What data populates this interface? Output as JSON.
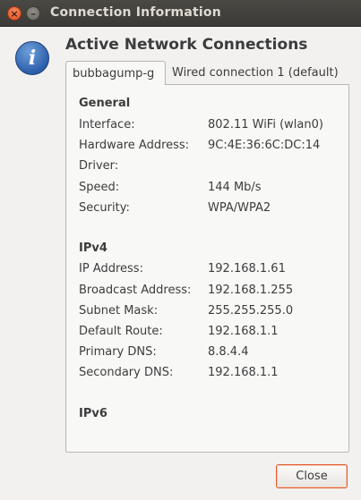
{
  "window": {
    "title": "Connection Information"
  },
  "icons": {
    "info": "info-icon"
  },
  "heading": "Active Network Connections",
  "tabs": [
    {
      "label": "bubbagump-g",
      "active": true
    },
    {
      "label": "Wired connection 1 (default)",
      "active": false
    }
  ],
  "general": {
    "title": "General",
    "rows": [
      {
        "label": "Interface:",
        "value": "802.11 WiFi (wlan0)"
      },
      {
        "label": "Hardware Address:",
        "value": "9C:4E:36:6C:DC:14"
      },
      {
        "label": "Driver:",
        "value": ""
      },
      {
        "label": "Speed:",
        "value": "144 Mb/s"
      },
      {
        "label": "Security:",
        "value": "WPA/WPA2"
      }
    ]
  },
  "ipv4": {
    "title": "IPv4",
    "rows": [
      {
        "label": "IP Address:",
        "value": "192.168.1.61"
      },
      {
        "label": "Broadcast Address:",
        "value": "192.168.1.255"
      },
      {
        "label": "Subnet Mask:",
        "value": "255.255.255.0"
      },
      {
        "label": "Default Route:",
        "value": "192.168.1.1"
      },
      {
        "label": "Primary DNS:",
        "value": "8.8.4.4"
      },
      {
        "label": "Secondary DNS:",
        "value": "192.168.1.1"
      }
    ]
  },
  "ipv6": {
    "title": "IPv6"
  },
  "buttons": {
    "close": "Close"
  },
  "colors": {
    "accent": "#e05a2b",
    "titlebar": "#3f3e3a",
    "info_blue": "#2b5fab"
  }
}
